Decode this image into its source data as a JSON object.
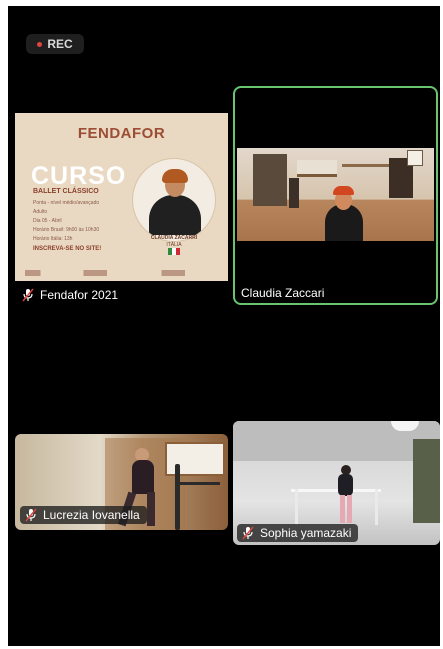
{
  "recording": {
    "label": "REC"
  },
  "participants": [
    {
      "name": "Fendafor 2021",
      "muted": true
    },
    {
      "name": "Claudia Zaccari",
      "muted": false,
      "active_speaker": true
    },
    {
      "name": "Lucrezia Iovanella",
      "muted": true
    },
    {
      "name": "Sophia yamazaki",
      "muted": true
    }
  ],
  "poster": {
    "logo": "FENDAFOR",
    "title": "CURSO",
    "subtitle": "BALLET CLÁSSICO",
    "info_lines": [
      "Ponta - nível médio/avançado",
      "Adulto",
      "Dia 05 - Abril",
      "Horário Brasil: 9h00 às 10h30",
      "Horário Itália: 13h"
    ],
    "cta": "INSCREVA-SE NO SITE!",
    "teacher": "CLAUDIA ZACARRI",
    "country": "ITÁLIA"
  },
  "colors": {
    "active_speaker_border": "#6ac36f",
    "rec_dot": "#e0453e",
    "background": "#000000"
  }
}
